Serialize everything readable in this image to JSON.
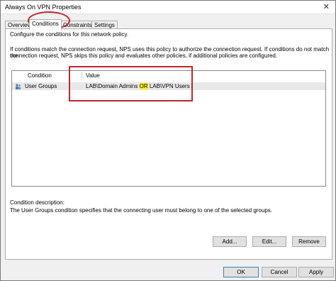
{
  "window": {
    "title": "Always On VPN Properties"
  },
  "tabs": [
    {
      "label": "Overview"
    },
    {
      "label": "Conditions"
    },
    {
      "label": "Constraints"
    },
    {
      "label": "Settings"
    }
  ],
  "panel": {
    "intro": "Configure the conditions for this network policy.",
    "description_line1": "If conditions match the connection request, NPS uses this policy to authorize the connection request. If conditions do not match the",
    "description_line2": "connection request, NPS skips this policy and evaluates other policies, if additional policies are configured."
  },
  "conditions_list": {
    "headers": {
      "condition": "Condition",
      "value": "Value"
    },
    "rows": [
      {
        "condition": "User Groups",
        "value_part1": "LAB\\Domain Admins ",
        "value_highlight": "OR",
        "value_part2": " LAB\\VPN Users"
      }
    ]
  },
  "condition_description": {
    "label": "Condition description:",
    "text": "The User Groups condition specifies that the connecting user must belong to one of the selected groups."
  },
  "list_buttons": {
    "add": "Add...",
    "edit": "Edit...",
    "remove": "Remove"
  },
  "dialog_buttons": {
    "ok": "OK",
    "cancel": "Cancel",
    "apply": "Apply"
  },
  "colors": {
    "annotation": "#c0262c",
    "highlight": "#fff200"
  }
}
